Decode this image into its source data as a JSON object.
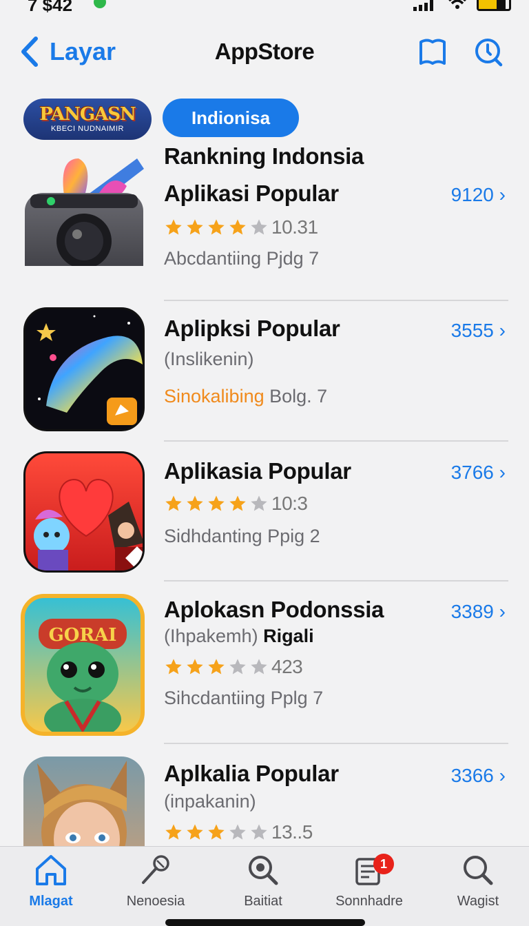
{
  "status_bar": {
    "time": "7 $42"
  },
  "nav": {
    "back_label": "Layar",
    "title": "AppStore"
  },
  "chips": {
    "banner_title": "PANGASN",
    "banner_subtitle": "KBECI NUDNAIMIR",
    "region": "Indionisa"
  },
  "list": {
    "heading": "Rankning Indonsia",
    "apps": [
      {
        "name": "Aplikasi Popular",
        "count": "9120 ›",
        "rating": 4,
        "rating_value": "10.31",
        "line": "Abcdantiing Pjdg 7"
      },
      {
        "name": "Aplipksi Popular",
        "count": "3555 ›",
        "subtitle": "(Inslikenin)",
        "line_orange": "Sinokalibing",
        "line_rest": " Bolg. 7"
      },
      {
        "name": "Aplikasia Popular",
        "count": "3766 ›",
        "rating": 4,
        "rating_value": "10:3",
        "line": "Sidhdanting Ppig 2"
      },
      {
        "name": "Aplokasn Podonssia",
        "count": "3389 ›",
        "subtitle": "(Ihpakemh)",
        "subtitle_bold": " Rigali",
        "rating": 3,
        "rating_value": "423",
        "line": "Sihcdantiing Pplg 7"
      },
      {
        "name": "Aplkalia Popular",
        "count": "3366 ›",
        "subtitle": "(inpakanin)",
        "rating": 3,
        "rating_value": "13..5"
      }
    ]
  },
  "tabs": [
    {
      "label": "Mlagat",
      "icon": "home-icon"
    },
    {
      "label": "Nenoesia",
      "icon": "microphone-icon"
    },
    {
      "label": "Baitiat",
      "icon": "magnifier-icon"
    },
    {
      "label": "Sonnhadre",
      "icon": "updates-icon",
      "badge": "1"
    },
    {
      "label": "Wagist",
      "icon": "search-icon"
    }
  ],
  "colors": {
    "accent": "#1a7ae8",
    "star": "#f6a21a",
    "badge": "#e8221a",
    "orange_text": "#f08a1c"
  }
}
